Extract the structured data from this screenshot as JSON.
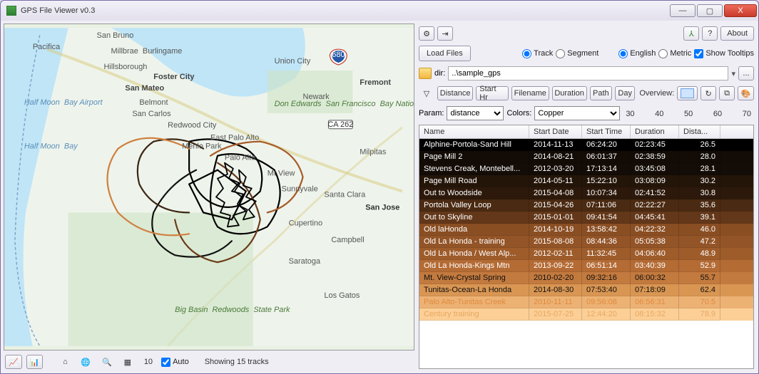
{
  "window": {
    "title": "GPS File Viewer v0.3"
  },
  "titlebar_buttons": {
    "min": "—",
    "max": "▢",
    "close": "X"
  },
  "toolbar": {
    "gear_name": "gear-icon",
    "import_name": "import-icon",
    "track3d_name": "3d-icon",
    "help_name": "help-icon",
    "about": "About",
    "load_files": "Load Files",
    "radio_track": "Track",
    "radio_segment": "Segment",
    "radio_english": "English",
    "radio_metric": "Metric",
    "show_tooltips": "Show Tooltips",
    "dir_label": "dir:",
    "dir_value": "..\\sample_gps",
    "browse": "..."
  },
  "filters": {
    "distance": "Distance",
    "start_hr": "Start Hr",
    "filename": "Filename",
    "duration": "Duration",
    "path": "Path",
    "day": "Day",
    "overview_label": "Overview:",
    "refresh_name": "refresh-icon",
    "chart_name": "chart-icon",
    "palette_name": "palette-icon"
  },
  "param": {
    "label": "Param:",
    "value": "distance",
    "colors_label": "Colors:",
    "colors_value": "Copper",
    "ticks": [
      "30",
      "40",
      "50",
      "60",
      "70"
    ]
  },
  "columns": {
    "name": "Name",
    "start_date": "Start Date",
    "start_time": "Start Time",
    "duration": "Duration",
    "distance": "Dista..."
  },
  "rows": [
    {
      "name": "Alphine-Portola-Sand Hill",
      "date": "2014-11-13",
      "time": "06:24:20",
      "dur": "02:23:45",
      "dist": "26.5",
      "bg": "#000000",
      "fg": "#ffffff"
    },
    {
      "name": "Page Mill 2",
      "date": "2014-08-21",
      "time": "06:01:37",
      "dur": "02:38:59",
      "dist": "28.0",
      "bg": "#120b06",
      "fg": "#ffffff"
    },
    {
      "name": "Stevens Creak, Montebell...",
      "date": "2012-03-20",
      "time": "17:13:14",
      "dur": "03:45:08",
      "dist": "28.1",
      "bg": "#140c06",
      "fg": "#ffffff"
    },
    {
      "name": "Page Mill Road",
      "date": "2014-05-11",
      "time": "15:22:10",
      "dur": "03:08:09",
      "dist": "30.2",
      "bg": "#241509",
      "fg": "#ffffff"
    },
    {
      "name": "Out to Woodside",
      "date": "2015-04-08",
      "time": "10:07:34",
      "dur": "02:41:52",
      "dist": "30.8",
      "bg": "#2c190b",
      "fg": "#ffffff"
    },
    {
      "name": "Portola Valley Loop",
      "date": "2015-04-26",
      "time": "07:11:06",
      "dur": "02:22:27",
      "dist": "35.6",
      "bg": "#4a2a12",
      "fg": "#ffffff"
    },
    {
      "name": "Out to Skyline",
      "date": "2015-01-01",
      "time": "09:41:54",
      "dur": "04:45:41",
      "dist": "39.1",
      "bg": "#633719",
      "fg": "#ffffff"
    },
    {
      "name": "Old laHonda",
      "date": "2014-10-19",
      "time": "13:58:42",
      "dur": "04:22:32",
      "dist": "46.0",
      "bg": "#8a4e23",
      "fg": "#ffffff"
    },
    {
      "name": "Old La Honda - training",
      "date": "2015-08-08",
      "time": "08:44:36",
      "dur": "05:05:38",
      "dist": "47.2",
      "bg": "#935427",
      "fg": "#ffffff"
    },
    {
      "name": "Old La Honda / West Alp...",
      "date": "2012-02-11",
      "time": "11:32:45",
      "dur": "04:06:40",
      "dist": "48.9",
      "bg": "#9e5c2b",
      "fg": "#ffffff"
    },
    {
      "name": "Old La Honda-Kings Mtn",
      "date": "2013-09-22",
      "time": "06:51:14",
      "dur": "03:40:39",
      "dist": "52.9",
      "bg": "#b46b34",
      "fg": "#ffffff"
    },
    {
      "name": "Mt. View-Crystal Spring",
      "date": "2010-02-20",
      "time": "09:32:16",
      "dur": "06:00:32",
      "dist": "55.7",
      "bg": "#c37a3e",
      "fg": "#111111"
    },
    {
      "name": "Tunitas-Ocean-La Honda",
      "date": "2014-08-30",
      "time": "07:53:40",
      "dur": "07:18:09",
      "dist": "62.4",
      "bg": "#d99653",
      "fg": "#111111"
    },
    {
      "name": "Palo Alto-Tunitas Creek",
      "date": "2010-11-11",
      "time": "09:56:08",
      "dur": "06:56:31",
      "dist": "70.5",
      "bg": "#ecb274",
      "fg": "#e08a40"
    },
    {
      "name": "Century training",
      "date": "2015-07-25",
      "time": "12:44:20",
      "dur": "08:15:32",
      "dist": "78.9",
      "bg": "#fccf97",
      "fg": "#e8a860"
    }
  ],
  "mapbar": {
    "label_10": "10",
    "auto": "Auto",
    "status": "Showing 15 tracks"
  },
  "map_labels": {
    "pacifica": "Pacifica",
    "san_bruno": "San Bruno",
    "millbrae": "Millbrae \nBurlingame",
    "hillsborough": "Hillsborough",
    "foster_city": "Foster City",
    "san_mateo": "San Mateo",
    "belmont": "Belmont",
    "san_carlos": "San Carlos",
    "redwood": "Redwood City",
    "menlo": "Menlo Park",
    "palo_alto": "Palo Alto",
    "epa": "East Palo Alto",
    "mv": "Mt View",
    "sunnyvale": "Sunnyvale",
    "santa_clara": "Santa Clara",
    "san_jose": "San Jose",
    "cupertino": "Cupertino",
    "campbell": "Campbell",
    "saratoga": "Saratoga",
    "los_gatos": "Los Gatos",
    "milpitas": "Milpitas",
    "fremont": "Fremont",
    "newark": "Newark",
    "union_city": "Union City",
    "half_moon_bay": "Half Moon \nBay",
    "hmba": "Half Moon \nBay Airport",
    "refuge": "Don Edwards \nSan Francisco \nBay National \nWildlife \nRefuge",
    "bigbasin": "Big Basin \nRedwoods \nState Park",
    "ca262": "CA 262",
    "i680": "680"
  }
}
